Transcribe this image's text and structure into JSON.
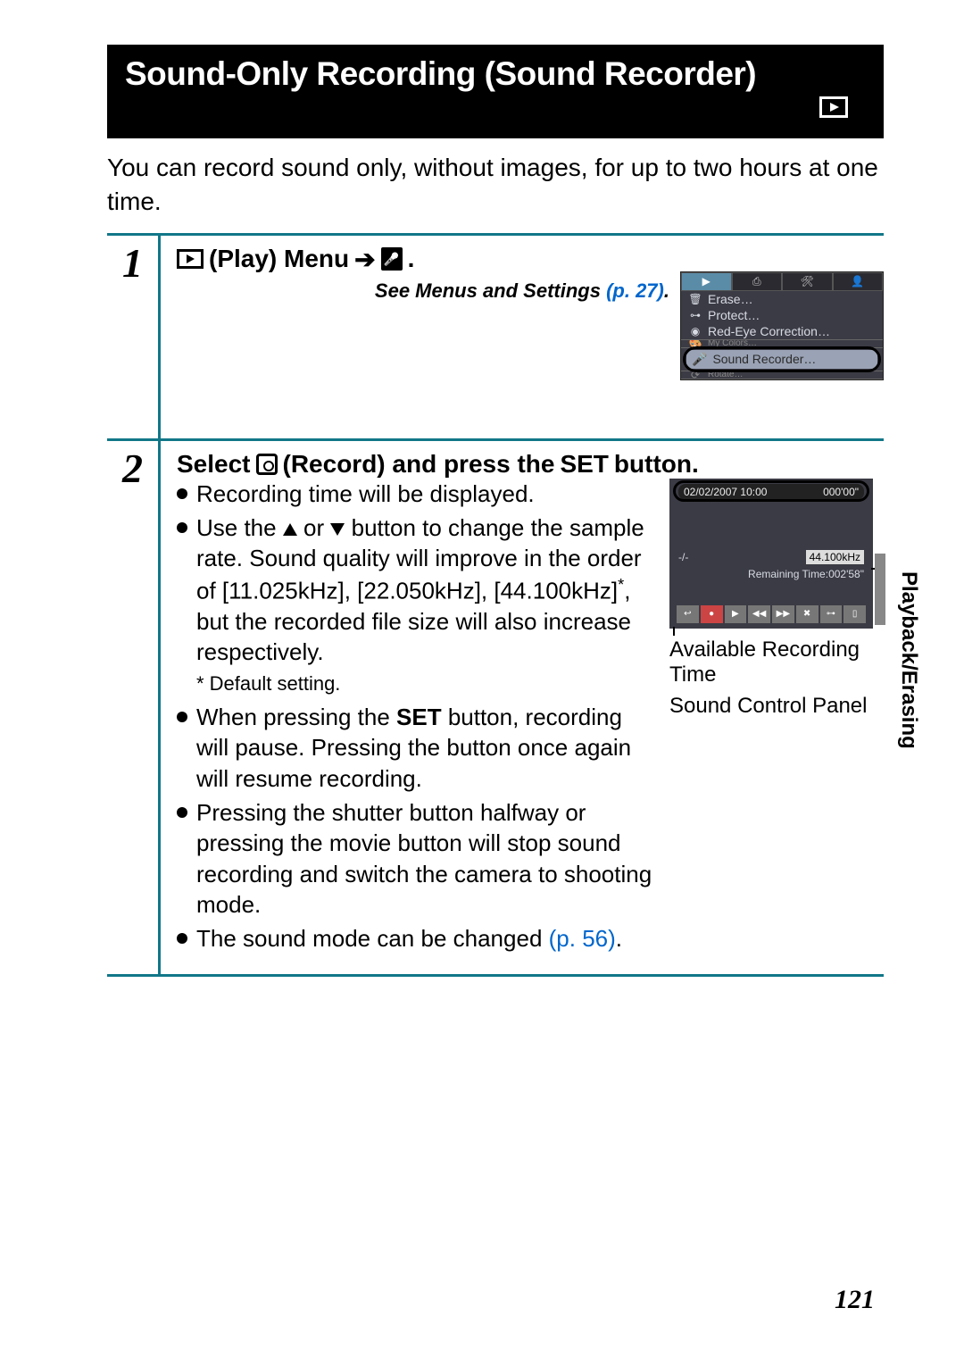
{
  "header": {
    "title": "Sound-Only Recording (Sound Recorder)"
  },
  "intro": "You can record sound only, without images, for up to two hours at one time.",
  "step1": {
    "number": "1",
    "head_a": "(Play) Menu",
    "period": ".",
    "see_prefix": "See Menus and Settings ",
    "see_link": "(p. 27)",
    "menu": {
      "erase": "Erase…",
      "protect": "Protect…",
      "redeye": "Red-Eye Correction…",
      "mycolors": "My Colors…",
      "sound": "Sound Recorder…",
      "rotate": "Rotate…"
    }
  },
  "step2": {
    "number": "2",
    "head_a": "Select",
    "head_b": "(Record) and press the",
    "head_c": "SET",
    "head_d": "button.",
    "b1": "Recording time will be displayed.",
    "b2a": "Use the ",
    "b2b": " or ",
    "b2c": " button to change the sample rate. Sound quality will improve in the order of [11.025kHz], [22.050kHz], [44.100kHz]",
    "b2d": ", but the recorded file size will also increase respectively.",
    "footnote": "* Default setting.",
    "b3a": "When pressing the ",
    "b3b": "SET",
    "b3c": " button, recording will pause. Pressing the button once again will resume recording.",
    "b4": "Pressing the shutter button halfway or pressing the movie button will stop sound recording and switch the camera to shooting mode.",
    "b5a": "The sound mode can be changed ",
    "b5b": "(p. 56)",
    "b5c": ".",
    "rec": {
      "date": "02/02/2007 10:00",
      "elapsed": "000'00\"",
      "track": "-/-",
      "khz": "44.100kHz",
      "remain": "Remaining Time:002'58\""
    },
    "cap1": "Available Recording Time",
    "cap2": "Sound Control Panel"
  },
  "side": "Playback/Erasing",
  "page": "121"
}
